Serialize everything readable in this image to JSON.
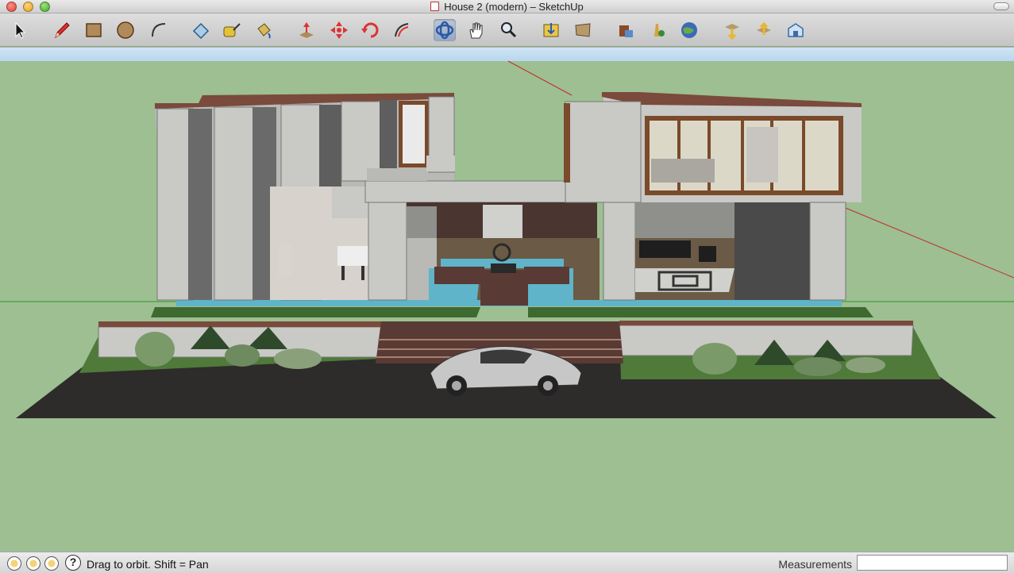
{
  "window": {
    "title": "House 2 (modern) – SketchUp"
  },
  "toolbar": {
    "tools": [
      {
        "name": "select",
        "icon": "arrow-cursor-icon"
      },
      {
        "name": "pencil",
        "icon": "pencil-icon"
      },
      {
        "name": "rectangle",
        "icon": "rectangle-icon"
      },
      {
        "name": "circle",
        "icon": "circle-icon"
      },
      {
        "name": "arc",
        "icon": "arc-icon"
      },
      {
        "name": "eraser",
        "icon": "eraser-icon"
      },
      {
        "name": "tape-measure",
        "icon": "tape-measure-icon"
      },
      {
        "name": "paint-bucket",
        "icon": "paint-bucket-icon"
      },
      {
        "name": "push-pull",
        "icon": "push-pull-icon"
      },
      {
        "name": "move",
        "icon": "move-icon"
      },
      {
        "name": "rotate",
        "icon": "rotate-icon"
      },
      {
        "name": "offset",
        "icon": "offset-icon"
      },
      {
        "name": "orbit",
        "icon": "orbit-icon",
        "active": true
      },
      {
        "name": "pan",
        "icon": "hand-icon"
      },
      {
        "name": "zoom",
        "icon": "magnifier-icon"
      },
      {
        "name": "zoom-extents",
        "icon": "zoom-extents-icon"
      },
      {
        "name": "previous-view",
        "icon": "previous-view-icon"
      },
      {
        "name": "get-models",
        "icon": "warehouse-icon"
      },
      {
        "name": "share-model",
        "icon": "share-model-icon"
      },
      {
        "name": "google-earth",
        "icon": "globe-icon"
      },
      {
        "name": "get-photo-texture",
        "icon": "photo-texture-icon"
      },
      {
        "name": "share-component",
        "icon": "share-component-icon"
      },
      {
        "name": "components",
        "icon": "components-icon"
      }
    ]
  },
  "statusbar": {
    "hint": "Drag to orbit.  Shift = Pan",
    "measurements_label": "Measurements",
    "measurements_value": ""
  },
  "colors": {
    "ground": "#9dbf92",
    "sky": "#c4ddf1",
    "concrete": "#c9c9c6",
    "roof": "#7a4a3c",
    "water": "#5fb4c9",
    "road": "#2e2b2b",
    "axis_red": "#c0302a",
    "axis_green": "#2a9a2a"
  }
}
